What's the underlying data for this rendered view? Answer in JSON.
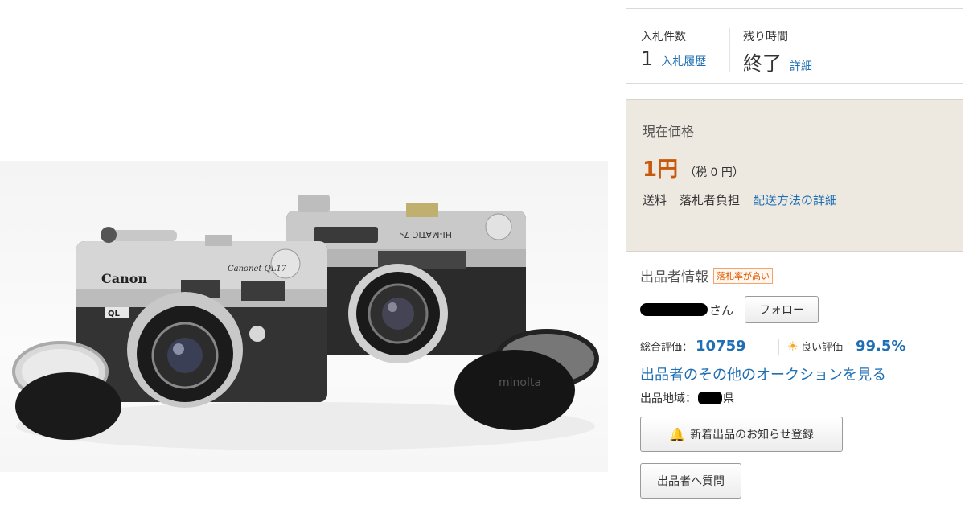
{
  "bids": {
    "count_label": "入札件数",
    "count_value": "1",
    "history_link": "入札履歴",
    "time_label": "残り時間",
    "time_value": "終了",
    "detail_link": "詳細"
  },
  "price": {
    "label": "現在価格",
    "value": "1円",
    "tax": "（税 0 円）",
    "shipping_label": "送料",
    "shipping_value": "落札者負担",
    "shipping_link": "配送方法の詳細"
  },
  "seller": {
    "title": "出品者情報",
    "badge": "落札率が高い",
    "honorific": "さん",
    "follow_button": "フォロー",
    "total_rating_label": "総合評価：",
    "total_rating_value": "10759",
    "good_rating_label": "良い評価",
    "good_rating_value": "99.5%",
    "other_auctions_link": "出品者のその他のオークションを見る",
    "region_label": "出品地域：",
    "region_suffix": "県",
    "notify_button": "新着出品のお知らせ登録",
    "question_button": "出品者へ質問"
  },
  "photo": {
    "camera1_brand": "Canon",
    "camera1_model": "Canonet QL17",
    "camera1_badge": "QL",
    "camera2_model": "HI-MATIC 7s",
    "camera2_brand": "minolta",
    "lens_cap_text": "minolta"
  },
  "colors": {
    "link": "#1f6fb5",
    "price": "#c9590a",
    "price_bg": "#ede9e1",
    "badge": "#e05a00"
  }
}
